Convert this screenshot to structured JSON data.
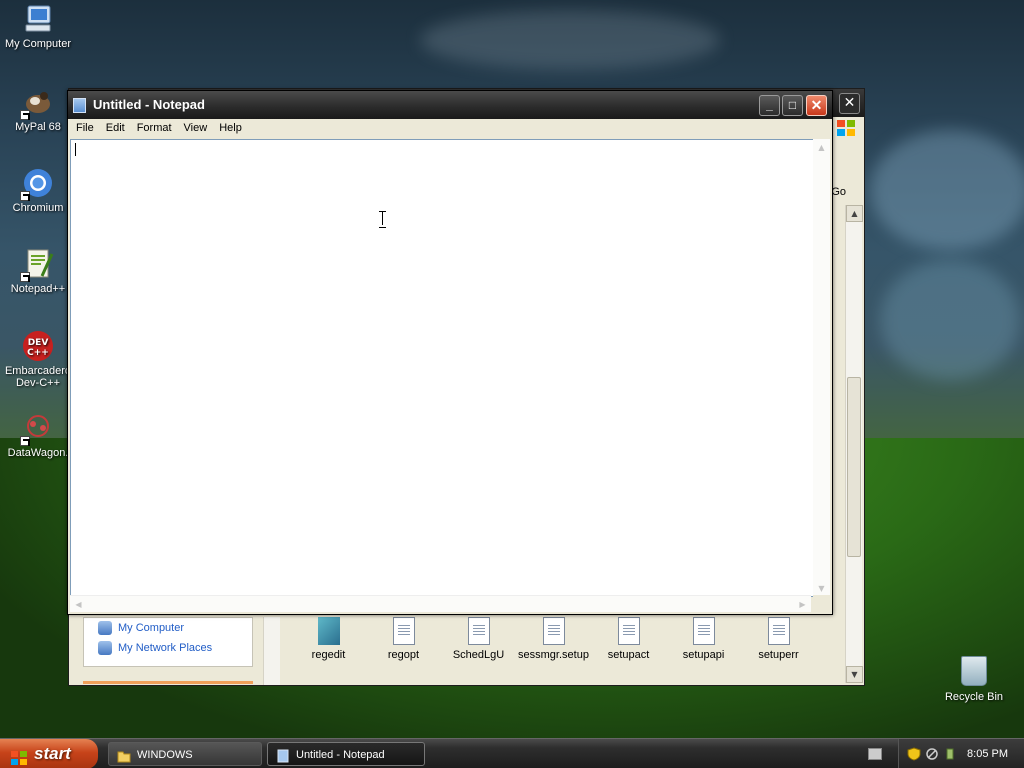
{
  "desktop": {
    "icons": [
      {
        "label": "My Computer"
      },
      {
        "label": "MyPal 68"
      },
      {
        "label": "Chromium"
      },
      {
        "label": "Notepad++"
      },
      {
        "label": "Embarcadero Dev-C++"
      },
      {
        "label": "DataWagon."
      }
    ],
    "recycle_bin": "Recycle Bin"
  },
  "explorer": {
    "go_label": "Go",
    "places": [
      "My Computer",
      "My Network Places"
    ],
    "files": [
      "regedit",
      "regopt",
      "SchedLgU",
      "sessmgr.setup",
      "setupact",
      "setupapi",
      "setuperr"
    ]
  },
  "notepad": {
    "title": "Untitled - Notepad",
    "menu": [
      "File",
      "Edit",
      "Format",
      "View",
      "Help"
    ],
    "content": "",
    "buttons": {
      "minimize": "_",
      "maximize": "□",
      "close": "✕"
    }
  },
  "taskbar": {
    "start_label": "start",
    "tasks": [
      {
        "label": "WINDOWS",
        "icon": "folder-icon",
        "active": false
      },
      {
        "label": "Untitled - Notepad",
        "icon": "notepad-icon",
        "active": true
      }
    ],
    "clock": "8:05 PM"
  },
  "colors": {
    "taskbar": "#2e2e2e",
    "start_button": "#c7431a",
    "close_button": "#c8381b",
    "title_bar": "#2a2a2a"
  }
}
